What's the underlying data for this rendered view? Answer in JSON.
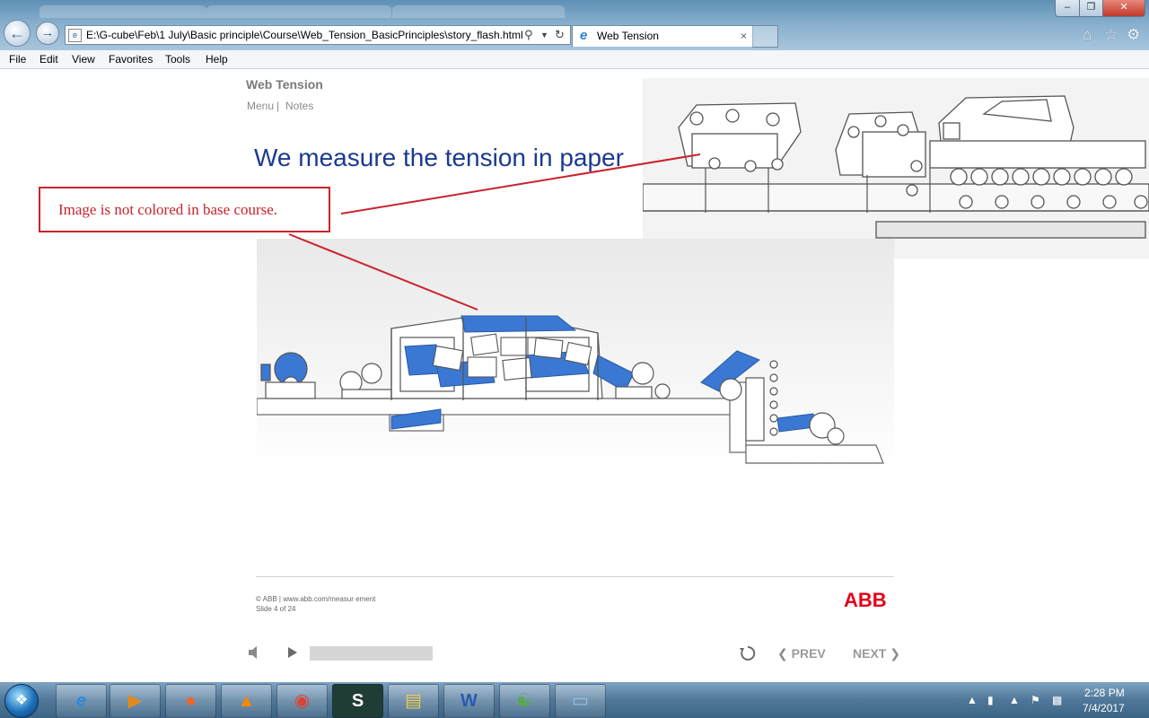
{
  "browser": {
    "address": "E:\\G-cube\\Feb\\1 July\\Basic principle\\Course\\Web_Tension_BasicPrinciples\\story_flash.html",
    "tab_title": "Web Tension",
    "tab_close": "×",
    "background_tabs": [
      "",
      "",
      ""
    ],
    "window_buttons": {
      "minimize": "‒",
      "restore": "❐",
      "close": "✕"
    },
    "icons": [
      "back-icon",
      "forward-icon",
      "search-icon",
      "refresh-icon",
      "home-icon",
      "favorites-star-icon",
      "tools-gear-icon"
    ]
  },
  "menubar": {
    "items": [
      "File",
      "Edit",
      "View",
      "Favorites",
      "Tools",
      "Help"
    ]
  },
  "slide": {
    "course_title": "Web Tension",
    "links": {
      "menu": "Menu",
      "separator": "|",
      "notes": "Notes"
    },
    "title": "We measure the tension in paper",
    "annotation": "Image is not colored in base course.",
    "footer_copyright": "© ABB | www.abb.com/measur ement",
    "footer_slide": "Slide 4 of 24",
    "logo_text": "ABB",
    "colors": {
      "title": "#1b3a8f",
      "annotation": "#c9232c",
      "logo": "#e2001a",
      "machine_accent": "#3a78d4"
    }
  },
  "player": {
    "prev_label": "PREV",
    "next_label": "NEXT",
    "prev_chevron": "❮",
    "next_chevron": "❯",
    "progress": 0
  },
  "taskbar": {
    "apps": [
      "internet-explorer",
      "media-player",
      "firefox",
      "vlc",
      "chrome",
      "app-s",
      "file-explorer",
      "word",
      "network-app",
      "notepad-app"
    ],
    "clock_time": "2:28 PM",
    "clock_date": "7/4/2017"
  }
}
